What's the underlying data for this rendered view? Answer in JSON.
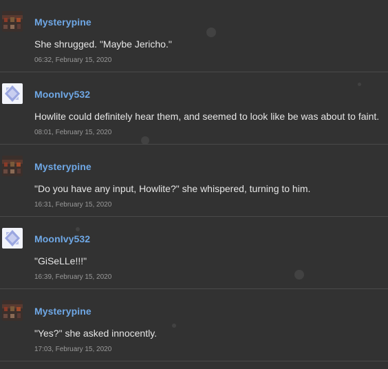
{
  "posts": [
    {
      "username": "Mysterypine",
      "avatar": "mysterypine-avatar",
      "message": "She shrugged. \"Maybe Jericho.\"",
      "timestamp": "06:32, February 15, 2020"
    },
    {
      "username": "MoonIvy532",
      "avatar": "moonivy532-avatar",
      "message": "Howlite could definitely hear them, and seemed to look like be was about to faint.",
      "timestamp": "08:01, February 15, 2020"
    },
    {
      "username": "Mysterypine",
      "avatar": "mysterypine-avatar",
      "message": "\"Do you have any input, Howlite?\" she whispered, turning to him.",
      "timestamp": "16:31, February 15, 2020"
    },
    {
      "username": "MoonIvy532",
      "avatar": "moonivy532-avatar",
      "message": "\"GiSeLLe!!!\"",
      "timestamp": "16:39, February 15, 2020"
    },
    {
      "username": "Mysterypine",
      "avatar": "mysterypine-avatar",
      "message": "\"Yes?\" she asked innocently.",
      "timestamp": "17:03, February 15, 2020"
    }
  ],
  "colors": {
    "background": "#323232",
    "username": "#6fa8e6",
    "message": "#e6e6e6",
    "timestamp": "#9a9a9a",
    "divider": "#4a4a4a"
  }
}
